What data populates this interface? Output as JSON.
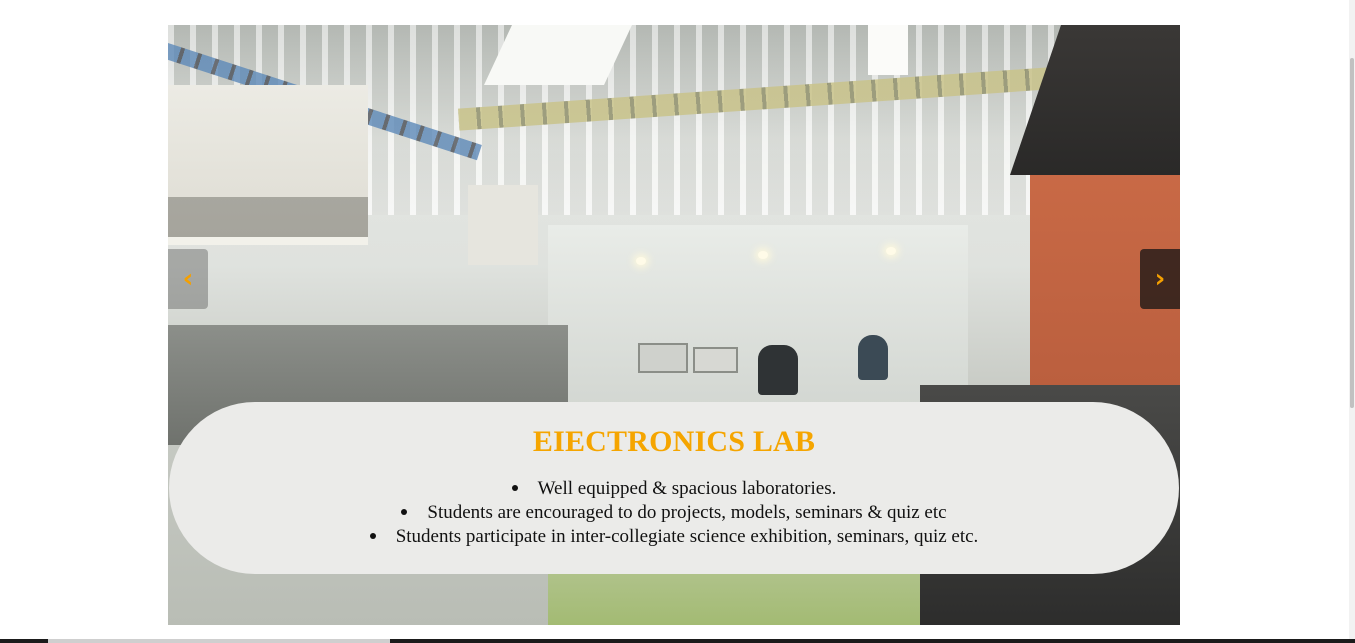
{
  "slider": {
    "image_alt": "electronics-lab-photo",
    "prev_icon": "‹",
    "next_icon": "›",
    "caption": {
      "title": "EIECTRONICS LAB",
      "points": [
        "Well equipped & spacious laboratories.",
        "Students are encouraged to do projects, models, seminars & quiz etc",
        "Students participate in inter-collegiate science exhibition, seminars, quiz etc."
      ]
    }
  },
  "colors": {
    "title": "#f5a500",
    "caption_bg": "#ebebe9",
    "arrow": "#f5a000"
  }
}
